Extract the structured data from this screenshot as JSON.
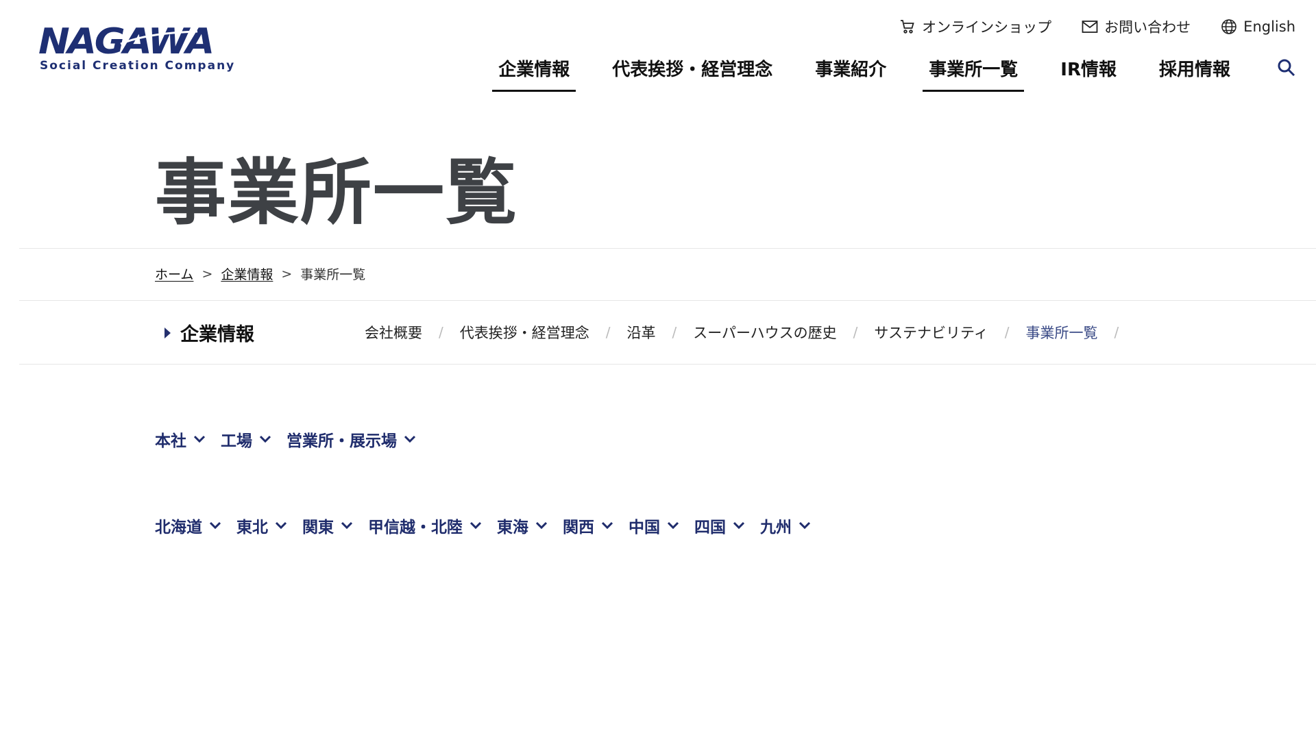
{
  "header": {
    "logo": {
      "wordmark": "NAGAWA",
      "tagline": "Social Creation Company",
      "color": "#1e2f73"
    },
    "utility": [
      {
        "icon": "cart-icon",
        "label": "オンラインショップ"
      },
      {
        "icon": "mail-icon",
        "label": "お問い合わせ"
      },
      {
        "icon": "globe-icon",
        "label": "English"
      }
    ],
    "nav": [
      {
        "label": "企業情報",
        "active": true
      },
      {
        "label": "代表挨拶・経営理念",
        "active": false
      },
      {
        "label": "事業紹介",
        "active": false
      },
      {
        "label": "事業所一覧",
        "active": true
      },
      {
        "label": "IR情報",
        "active": false
      },
      {
        "label": "採用情報",
        "active": false
      }
    ],
    "search_icon": "search-icon"
  },
  "page": {
    "title": "事業所一覧"
  },
  "breadcrumb": {
    "home": "ホーム",
    "sep": ">",
    "parent": "企業情報",
    "current": "事業所一覧"
  },
  "section": {
    "title": "企業情報",
    "items": [
      "会社概要",
      "代表挨拶・経営理念",
      "沿革",
      "スーパーハウスの歴史",
      "サステナビリティ",
      "事業所一覧"
    ],
    "current_index": 5,
    "separator": "/"
  },
  "filters": {
    "types": [
      "本社",
      "工場",
      "営業所・展示場"
    ],
    "regions": [
      "北海道",
      "東北",
      "関東",
      "甲信越・北陸",
      "東海",
      "関西",
      "中国",
      "四国",
      "九州"
    ]
  },
  "colors": {
    "brand": "#1e2f73",
    "link": "#1f2c6c",
    "title": "#3e4145"
  }
}
